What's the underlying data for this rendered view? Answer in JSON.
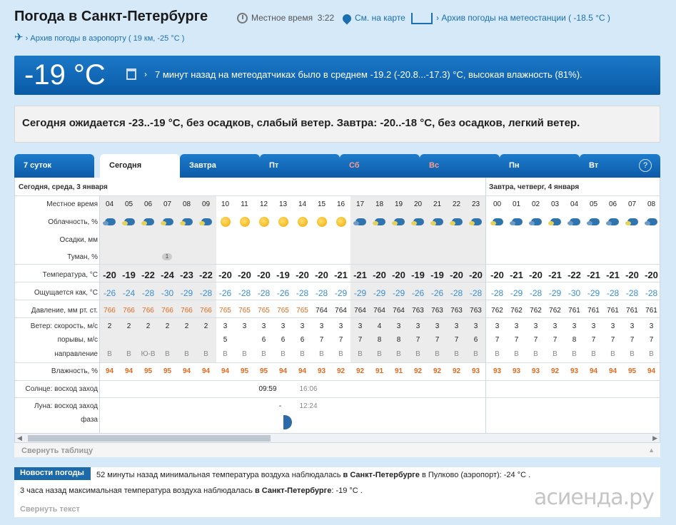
{
  "header": {
    "title": "Погода в Санкт-Петербурге",
    "local_time_label": "Местное время",
    "local_time_value": "3:22",
    "map_link": "См. на карте",
    "archive_station": "Архив погоды на метеостанции ( -18.5 °C )",
    "archive_airport": "Архив погоды в аэропорту ( 19 км, -25 °C )"
  },
  "current": {
    "temp": "-19 °C",
    "text": "7 минут назад на метеодатчиках было в среднем -19.2 (-20.8...-17.3) °C, высокая влажность (81%)."
  },
  "forecast_text": "Сегодня ожидается -23..-19 °C, без осадков, слабый ветер. Завтра: -20..-18 °C, без осадков, легкий ветер.",
  "tabs": [
    {
      "label": "7 суток"
    },
    {
      "label": "Сегодня"
    },
    {
      "label": "Завтра"
    },
    {
      "label": "Пт"
    },
    {
      "label": "Сб"
    },
    {
      "label": "Вс"
    },
    {
      "label": "Пн"
    },
    {
      "label": "Вт"
    }
  ],
  "help": "?",
  "table": {
    "today_label": "Сегодня, среда, 3 января",
    "tomorrow_label": "Завтра, четверг, 4 января",
    "row_labels": {
      "time": "Местное время",
      "clouds": "Облачность, %",
      "precip": "Осадки, мм",
      "fog": "Туман, %",
      "temp": "Температура, °С",
      "feels": "Ощущается как, °С",
      "pressure": "Давление, мм рт. ст.",
      "wind_speed": "Ветер: скорость, м/с",
      "gusts": "порывы, м/с",
      "direction": "направление",
      "humidity": "Влажность, %",
      "sun": "Солнце: восход заход",
      "moon": "Луна: восход заход",
      "phase": "фаза"
    },
    "hours": [
      "04",
      "05",
      "06",
      "07",
      "08",
      "09",
      "10",
      "11",
      "12",
      "13",
      "14",
      "15",
      "16",
      "17",
      "18",
      "19",
      "20",
      "21",
      "22",
      "23",
      "00",
      "01",
      "02",
      "03",
      "04",
      "05",
      "06",
      "07",
      "08"
    ],
    "clouds": [
      "dense",
      "cloud",
      "cloud",
      "cloud",
      "cloud",
      "cloud",
      "sun",
      "sun",
      "sun",
      "sun",
      "sun",
      "sun",
      "sun",
      "dense",
      "cloud",
      "cloud",
      "cloud",
      "cloud",
      "cloud",
      "cloud",
      "cloud",
      "dense",
      "dense",
      "cloud",
      "dense",
      "dense",
      "dense",
      "cloud",
      "dense"
    ],
    "fog_value": "1",
    "temp": [
      "-20",
      "-19",
      "-22",
      "-24",
      "-23",
      "-22",
      "-20",
      "-20",
      "-20",
      "-19",
      "-20",
      "-20",
      "-21",
      "-21",
      "-20",
      "-20",
      "-19",
      "-19",
      "-20",
      "-20",
      "-20",
      "-21",
      "-20",
      "-21",
      "-22",
      "-21",
      "-21",
      "-20",
      "-20"
    ],
    "feels": [
      "-26",
      "-24",
      "-28",
      "-30",
      "-29",
      "-28",
      "-26",
      "-28",
      "-28",
      "-26",
      "-28",
      "-28",
      "-29",
      "-29",
      "-29",
      "-29",
      "-26",
      "-26",
      "-28",
      "-28",
      "-28",
      "-29",
      "-28",
      "-29",
      "-30",
      "-29",
      "-28",
      "-28",
      "-28"
    ],
    "pressure": [
      "766",
      "766",
      "766",
      "766",
      "766",
      "766",
      "765",
      "765",
      "765",
      "765",
      "765",
      "764",
      "764",
      "764",
      "764",
      "764",
      "763",
      "763",
      "763",
      "763",
      "762",
      "762",
      "762",
      "762",
      "761",
      "761",
      "761",
      "761",
      "761"
    ],
    "pressure_red_count": 11,
    "wind": [
      "2",
      "2",
      "2",
      "2",
      "2",
      "2",
      "3",
      "3",
      "3",
      "3",
      "3",
      "3",
      "3",
      "3",
      "4",
      "3",
      "3",
      "3",
      "3",
      "3",
      "3",
      "3",
      "3",
      "3",
      "3",
      "3",
      "3",
      "3",
      "3"
    ],
    "gusts": [
      "",
      "",
      "",
      "",
      "",
      "",
      "5",
      "",
      "6",
      "6",
      "6",
      "7",
      "7",
      "7",
      "8",
      "8",
      "7",
      "7",
      "7",
      "6",
      "7",
      "7",
      "7",
      "7",
      "8",
      "7",
      "7",
      "7",
      "7"
    ],
    "direction": [
      "В",
      "В",
      "Ю-В",
      "В",
      "В",
      "В",
      "В",
      "В",
      "В",
      "В",
      "В",
      "В",
      "В",
      "В",
      "В",
      "В",
      "В",
      "В",
      "В",
      "В",
      "В",
      "В",
      "В",
      "В",
      "В",
      "В",
      "В",
      "В",
      "В"
    ],
    "humidity": [
      "94",
      "94",
      "95",
      "95",
      "94",
      "94",
      "94",
      "95",
      "95",
      "94",
      "94",
      "93",
      "92",
      "92",
      "91",
      "91",
      "92",
      "92",
      "92",
      "93",
      "93",
      "93",
      "93",
      "92",
      "93",
      "94",
      "94",
      "95",
      "94"
    ],
    "sunrise": "09:59",
    "sunset": "16:06",
    "moonrise": "-",
    "moonset": "12:24",
    "collapse": "Свернуть таблицу"
  },
  "news": {
    "tag": "Новости погоды",
    "line1_pre": "52 минуты назад минимальная температура воздуха наблюдалась",
    "line1_city": "в Санкт-Петербурге",
    "line1_post": "в Пулково (аэропорт): -24 °С .",
    "line2_pre": "3 часа назад максимальная температура воздуха наблюдалась",
    "line2_city": "в Санкт-Петербурге",
    "line2_post": ": -19 °С .",
    "collapse": "Свернуть текст"
  },
  "watermark": "асиенда.ру",
  "colors": {
    "banner": "#0a5aa6",
    "tab": "#1d7ccc",
    "humidity": "#e06a1f",
    "feels": "#3a8fd0"
  }
}
